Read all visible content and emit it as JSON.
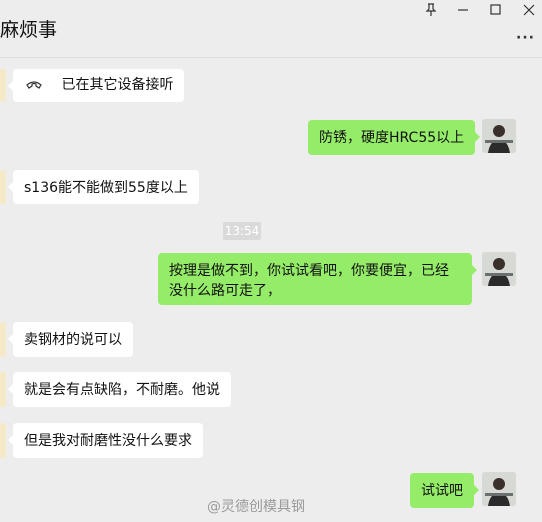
{
  "window": {
    "title": "麻烦事",
    "more_label": "···",
    "controls": [
      "pin-icon",
      "minimize-icon",
      "maximize-icon",
      "close-icon"
    ]
  },
  "messages": [
    {
      "side": "in",
      "icon": "phone-icon",
      "text": "已在其它设备接听"
    },
    {
      "side": "out",
      "text": "防锈，硬度HRC55以上"
    },
    {
      "side": "in",
      "text": "s136能不能做到55度以上"
    },
    {
      "side": "out",
      "text": "按理是做不到，你试试看吧，你要便宜，已经没什么路可走了，"
    },
    {
      "side": "in",
      "text": "卖钢材的说可以"
    },
    {
      "side": "in",
      "text": "就是会有点缺陷，不耐磨。他说"
    },
    {
      "side": "in",
      "text": "但是我对耐磨性没什么要求"
    },
    {
      "side": "out",
      "text": "试试吧"
    }
  ],
  "timestamp": "13:54",
  "watermark": "@灵德创模具钢",
  "colors": {
    "outgoing_bubble": "#95ec69",
    "incoming_bubble": "#ffffff",
    "background": "#ededed"
  }
}
